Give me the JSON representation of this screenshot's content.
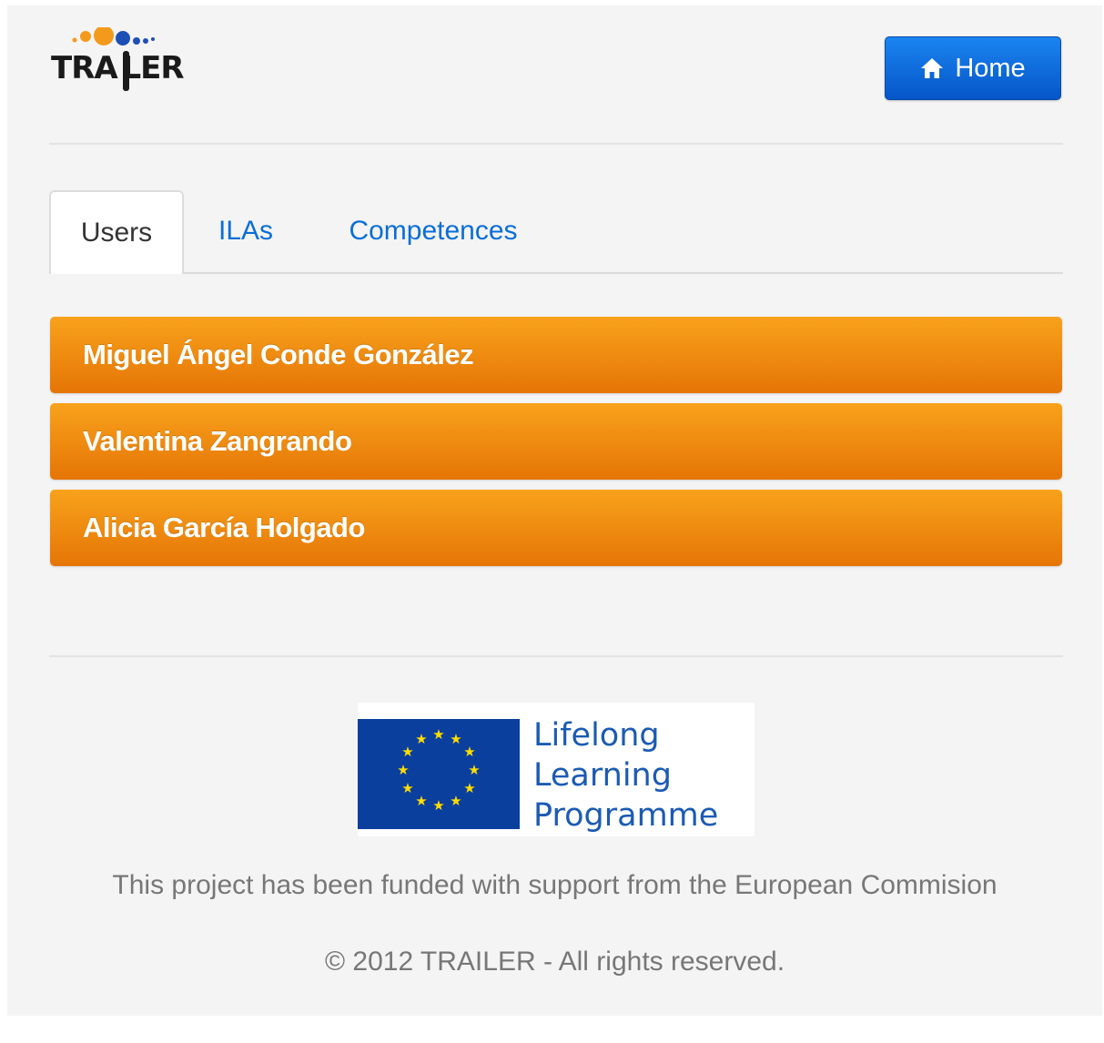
{
  "brand": {
    "name": "TRAILER"
  },
  "header": {
    "home_label": "Home"
  },
  "tabs": [
    {
      "label": "Users",
      "active": true
    },
    {
      "label": "ILAs",
      "active": false
    },
    {
      "label": "Competences",
      "active": false
    }
  ],
  "users": [
    "Miguel Ángel Conde González",
    "Valentina Zangrando",
    "Alicia García Holgado"
  ],
  "footer": {
    "eu_program_lines": [
      "Lifelong",
      "Learning",
      "Programme"
    ],
    "funded_text": "This project has been funded with support from the European Commision",
    "copyright": "© 2012 TRAILER - All rights reserved."
  },
  "colors": {
    "primary_button": "#0a6ed8",
    "list_item": "#f08a10",
    "eu_blue": "#0b3f9e",
    "eu_star": "#ffdd00"
  }
}
